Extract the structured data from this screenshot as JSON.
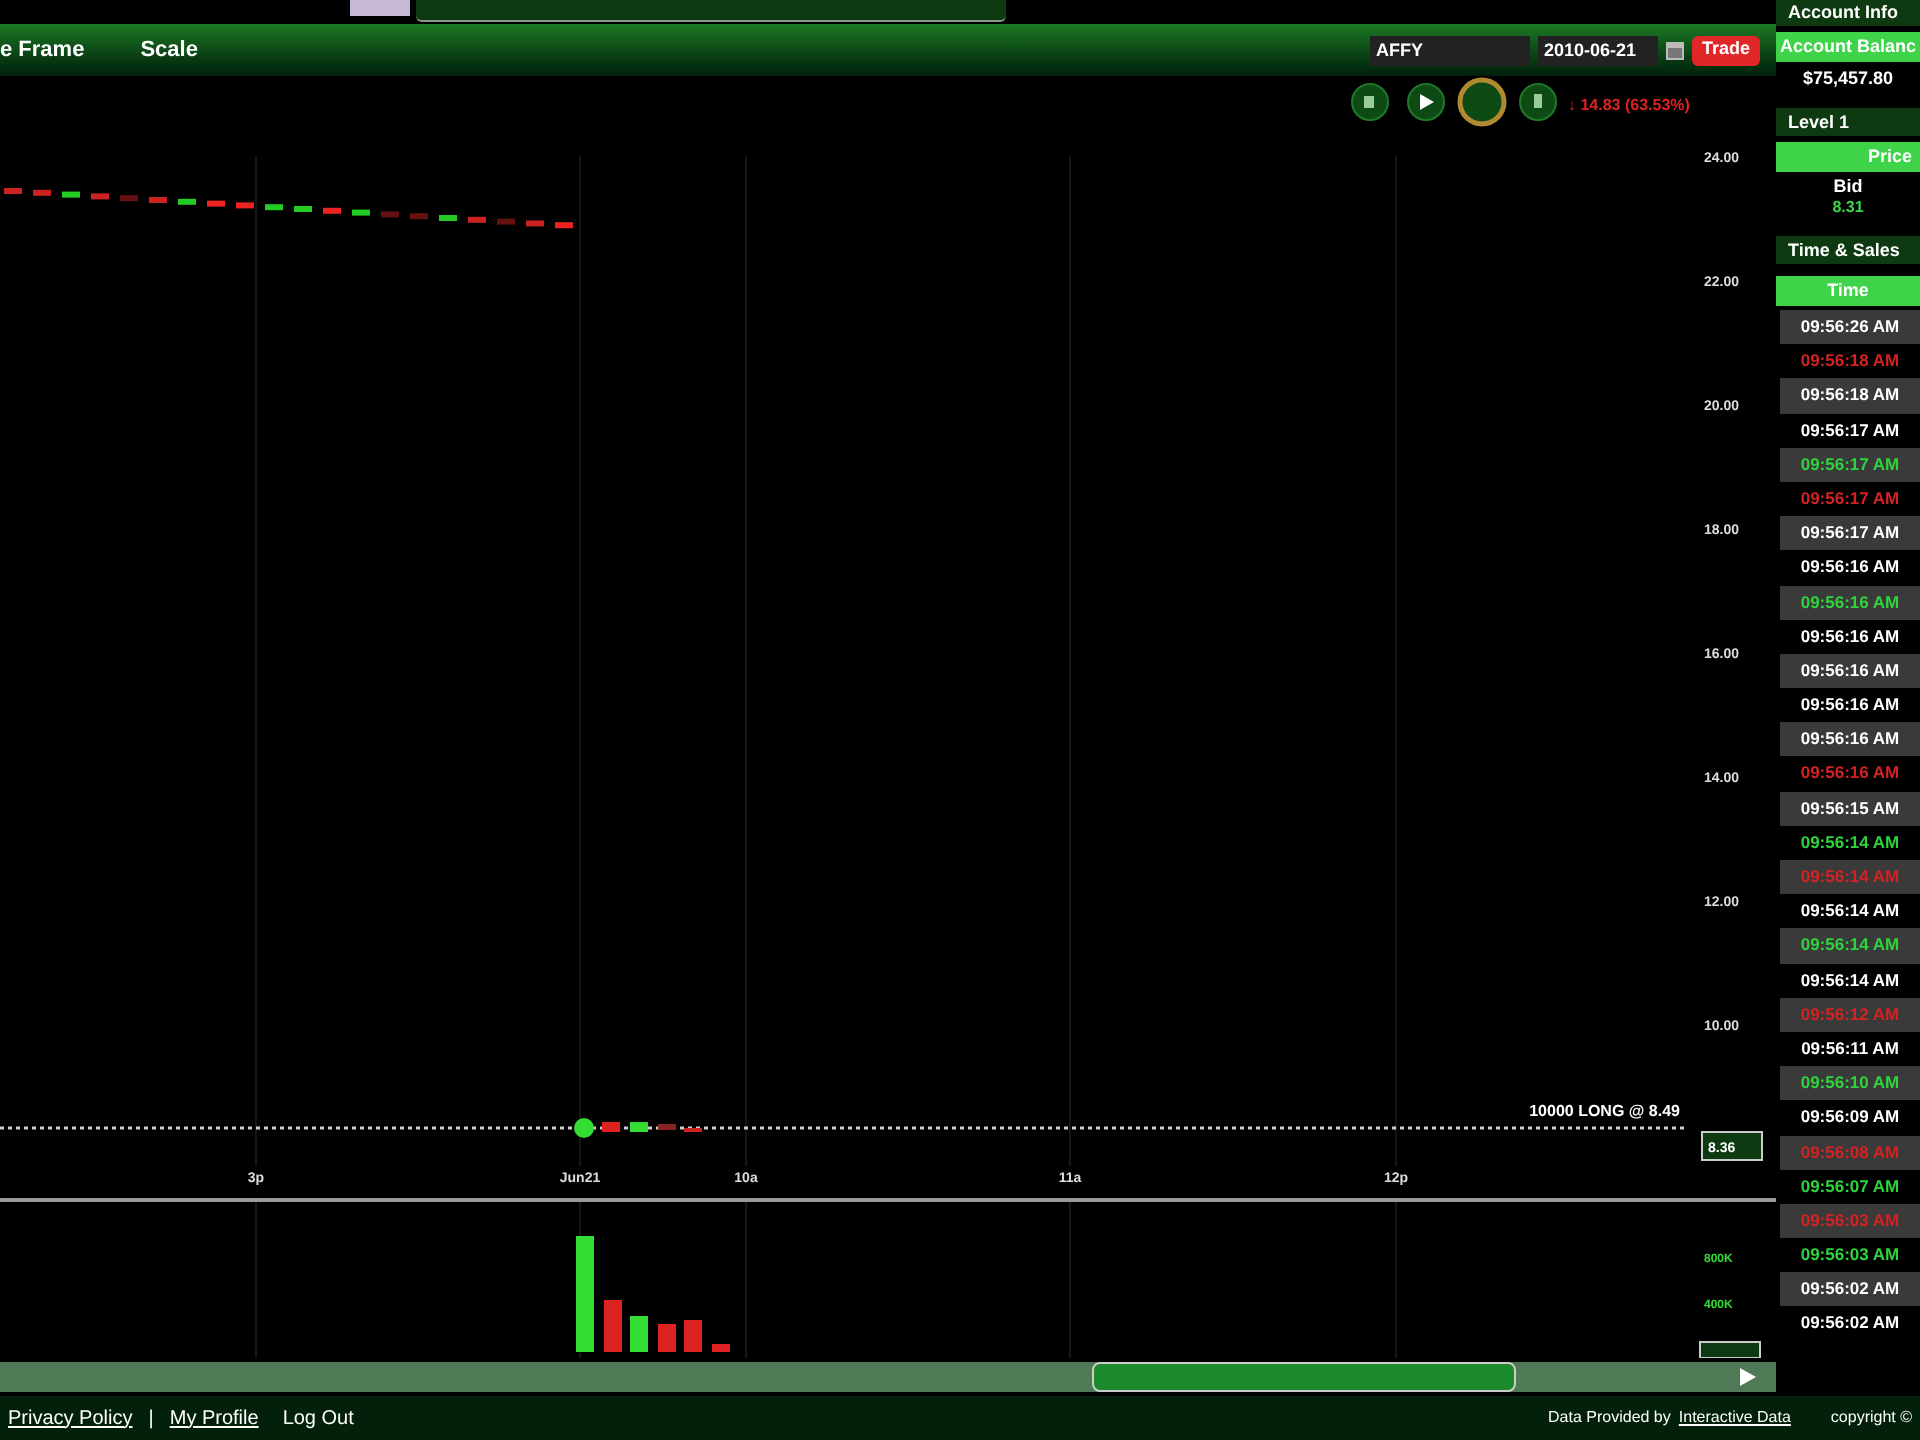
{
  "header": {
    "menu": [
      "e Frame",
      "Scale"
    ],
    "symbol": "AFFY",
    "date": "2010-06-21",
    "trade_button": "Trade",
    "change": "↓ 14.83 (63.53%)"
  },
  "chart": {
    "price_ticks": [
      "24.00",
      "22.00",
      "20.00",
      "18.00",
      "16.00",
      "14.00",
      "12.00",
      "10.00"
    ],
    "time_ticks": [
      "3p",
      "Jun21",
      "10a",
      "11a",
      "12p"
    ],
    "position_label": "10000 LONG @ 8.49",
    "last_price": "8.36",
    "volume_ticks": [
      "800K",
      "400K"
    ]
  },
  "account": {
    "title": "Account Info",
    "balance_label": "Account Balanc",
    "balance": "$75,457.80"
  },
  "level1": {
    "title": "Level 1",
    "column": "Price",
    "bid_label": "Bid",
    "bid": "8.31"
  },
  "time_sales": {
    "title": "Time & Sales",
    "column": "Time",
    "rows": [
      {
        "time": "09:56:26 AM",
        "uptick": false,
        "downtick": false
      },
      {
        "time": "09:56:18 AM",
        "uptick": false,
        "downtick": true
      },
      {
        "time": "09:56:18 AM",
        "uptick": false,
        "downtick": false
      },
      {
        "time": "09:56:17 AM",
        "uptick": false,
        "downtick": false
      },
      {
        "time": "09:56:17 AM",
        "uptick": true,
        "downtick": false
      },
      {
        "time": "09:56:17 AM",
        "uptick": false,
        "downtick": true
      },
      {
        "time": "09:56:17 AM",
        "uptick": false,
        "downtick": false
      },
      {
        "time": "09:56:16 AM",
        "uptick": false,
        "downtick": false
      },
      {
        "time": "09:56:16 AM",
        "uptick": true,
        "downtick": false
      },
      {
        "time": "09:56:16 AM",
        "uptick": false,
        "downtick": false
      },
      {
        "time": "09:56:16 AM",
        "uptick": false,
        "downtick": false
      },
      {
        "time": "09:56:16 AM",
        "uptick": false,
        "downtick": false
      },
      {
        "time": "09:56:16 AM",
        "uptick": false,
        "downtick": false
      },
      {
        "time": "09:56:16 AM",
        "uptick": false,
        "downtick": true
      },
      {
        "time": "09:56:15 AM",
        "uptick": false,
        "downtick": false
      },
      {
        "time": "09:56:14 AM",
        "uptick": true,
        "downtick": false
      },
      {
        "time": "09:56:14 AM",
        "uptick": false,
        "downtick": true
      },
      {
        "time": "09:56:14 AM",
        "uptick": false,
        "downtick": false
      },
      {
        "time": "09:56:14 AM",
        "uptick": true,
        "downtick": false
      },
      {
        "time": "09:56:14 AM",
        "uptick": false,
        "downtick": false
      },
      {
        "time": "09:56:12 AM",
        "uptick": false,
        "downtick": true
      },
      {
        "time": "09:56:11 AM",
        "uptick": false,
        "downtick": false
      },
      {
        "time": "09:56:10 AM",
        "uptick": true,
        "downtick": false
      },
      {
        "time": "09:56:09 AM",
        "uptick": false,
        "downtick": false
      },
      {
        "time": "09:56:08 AM",
        "uptick": false,
        "downtick": true
      },
      {
        "time": "09:56:07 AM",
        "uptick": true,
        "downtick": false
      },
      {
        "time": "09:56:03 AM",
        "uptick": false,
        "downtick": true
      },
      {
        "time": "09:56:03 AM",
        "uptick": true,
        "downtick": false
      },
      {
        "time": "09:56:02 AM",
        "uptick": false,
        "downtick": false
      },
      {
        "time": "09:56:02 AM",
        "uptick": false,
        "downtick": false
      }
    ]
  },
  "footer": {
    "links": [
      "Privacy Policy",
      "My Profile",
      "Log Out"
    ],
    "separator": "|",
    "data_text": "Data Provided by",
    "data_link": "Interactive Data",
    "copyright": "copyright ©"
  }
}
